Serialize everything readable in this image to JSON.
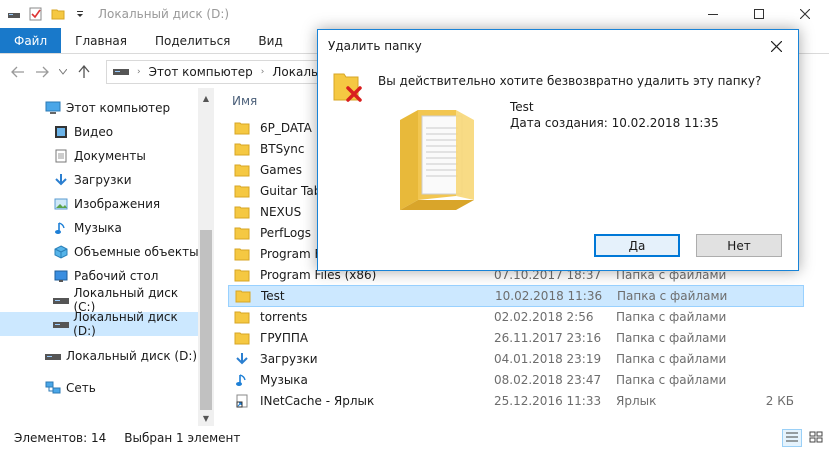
{
  "window": {
    "title": "Локальный диск (D:)"
  },
  "ribbon": {
    "tabs": [
      "Файл",
      "Главная",
      "Поделиться",
      "Вид"
    ]
  },
  "address": {
    "crumbs": [
      "Этот компьютер",
      "Локальный"
    ]
  },
  "sidebar": {
    "items": [
      {
        "label": "Этот компьютер",
        "icon": "computer-icon"
      },
      {
        "label": "Видео",
        "icon": "video-icon"
      },
      {
        "label": "Документы",
        "icon": "documents-icon"
      },
      {
        "label": "Загрузки",
        "icon": "downloads-icon"
      },
      {
        "label": "Изображения",
        "icon": "pictures-icon"
      },
      {
        "label": "Музыка",
        "icon": "music-icon"
      },
      {
        "label": "Объемные объекты",
        "icon": "3d-objects-icon"
      },
      {
        "label": "Рабочий стол",
        "icon": "desktop-icon"
      },
      {
        "label": "Локальный диск (C:)",
        "icon": "drive-icon"
      },
      {
        "label": "Локальный диск (D:)",
        "icon": "drive-icon"
      },
      {
        "label": "Локальный диск (D:)",
        "icon": "drive-icon"
      },
      {
        "label": "Сеть",
        "icon": "network-icon"
      }
    ]
  },
  "filelist": {
    "column_name": "Имя",
    "rows": [
      {
        "name": "6P_DATA",
        "date": "",
        "type": "",
        "size": "",
        "icon": "folder-icon"
      },
      {
        "name": "BTSync",
        "date": "",
        "type": "",
        "size": "",
        "icon": "folder-icon"
      },
      {
        "name": "Games",
        "date": "",
        "type": "",
        "size": "",
        "icon": "folder-icon"
      },
      {
        "name": "Guitar Tabs",
        "date": "",
        "type": "",
        "size": "",
        "icon": "folder-icon"
      },
      {
        "name": "NEXUS",
        "date": "",
        "type": "",
        "size": "",
        "icon": "folder-icon"
      },
      {
        "name": "PerfLogs",
        "date": "",
        "type": "",
        "size": "",
        "icon": "folder-icon"
      },
      {
        "name": "Program Files",
        "date": "",
        "type": "",
        "size": "",
        "icon": "folder-icon"
      },
      {
        "name": "Program Files (x86)",
        "date": "07.10.2017 18:37",
        "type": "Папка с файлами",
        "size": "",
        "icon": "folder-icon"
      },
      {
        "name": "Test",
        "date": "10.02.2018 11:36",
        "type": "Папка с файлами",
        "size": "",
        "icon": "folder-icon"
      },
      {
        "name": "torrents",
        "date": "02.02.2018 2:56",
        "type": "Папка с файлами",
        "size": "",
        "icon": "folder-icon"
      },
      {
        "name": "ГРУППА",
        "date": "26.11.2017 23:16",
        "type": "Папка с файлами",
        "size": "",
        "icon": "folder-icon"
      },
      {
        "name": "Загрузки",
        "date": "04.01.2018 23:19",
        "type": "Папка с файлами",
        "size": "",
        "icon": "downloads-icon"
      },
      {
        "name": "Музыка",
        "date": "08.02.2018 23:47",
        "type": "Папка с файлами",
        "size": "",
        "icon": "music-icon"
      },
      {
        "name": "INetCache - Ярлык",
        "date": "25.12.2016 11:33",
        "type": "Ярлык",
        "size": "2 КБ",
        "icon": "shortcut-icon"
      }
    ]
  },
  "status": {
    "count": "Элементов: 14",
    "selected": "Выбран 1 элемент"
  },
  "dialog": {
    "title": "Удалить папку",
    "question": "Вы действительно хотите безвозвратно удалить эту папку?",
    "folder_name": "Test",
    "created_label": "Дата создания:",
    "created_value": "10.02.2018 11:35",
    "yes_label": "Да",
    "yes_accel": "Д",
    "yes_rest": "а",
    "no_label": "Нет"
  },
  "colors": {
    "accent": "#1979ca",
    "selection": "#cce8ff",
    "folder": "#f5c842"
  }
}
